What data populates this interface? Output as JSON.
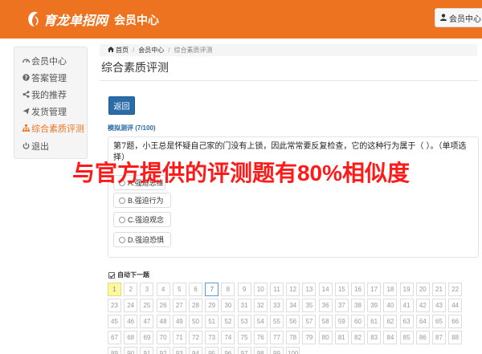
{
  "header": {
    "logo_text": "育龙单招网",
    "title": "会员中心",
    "user_button_label": "会员中心"
  },
  "sidebar": {
    "items": [
      {
        "label": "会员中心",
        "icon": "dashboard-icon",
        "active": false
      },
      {
        "label": "答案管理",
        "icon": "question-icon",
        "active": false
      },
      {
        "label": "我的推荐",
        "icon": "share-icon",
        "active": false
      },
      {
        "label": "发货管理",
        "icon": "send-icon",
        "active": false
      },
      {
        "label": "综合素质评测",
        "icon": "sitemap-icon",
        "active": true
      },
      {
        "label": "退出",
        "icon": "power-icon",
        "active": false
      }
    ]
  },
  "breadcrumb": {
    "home": "首页",
    "level1": "会员中心",
    "current": "综合素质评测"
  },
  "page": {
    "title": "综合素质评测",
    "back_label": "返回",
    "mock_label": "模拟测评 (7/100)",
    "question_text": "第7题，小王总是怀疑自己家的门没有上锁，因此常常要反复检查，它的这种行为属于（ ）。（单项选择）",
    "options": [
      {
        "label": "A.强迫思维"
      },
      {
        "label": "B.强迫行为"
      },
      {
        "label": "C.强迫观念"
      },
      {
        "label": "D.强迫恐惧"
      }
    ],
    "auto_next_label": "自动下一题",
    "auto_next_checked": true,
    "current_question": 7,
    "answered": [
      1
    ]
  },
  "watermark": "与官方提供的评测题有80%相似度",
  "colors": {
    "brand_orange": "#ee7321",
    "primary_blue": "#2a6ca8",
    "watermark_red": "#ff1a1a",
    "answered_yellow": "#fdf7a0"
  }
}
